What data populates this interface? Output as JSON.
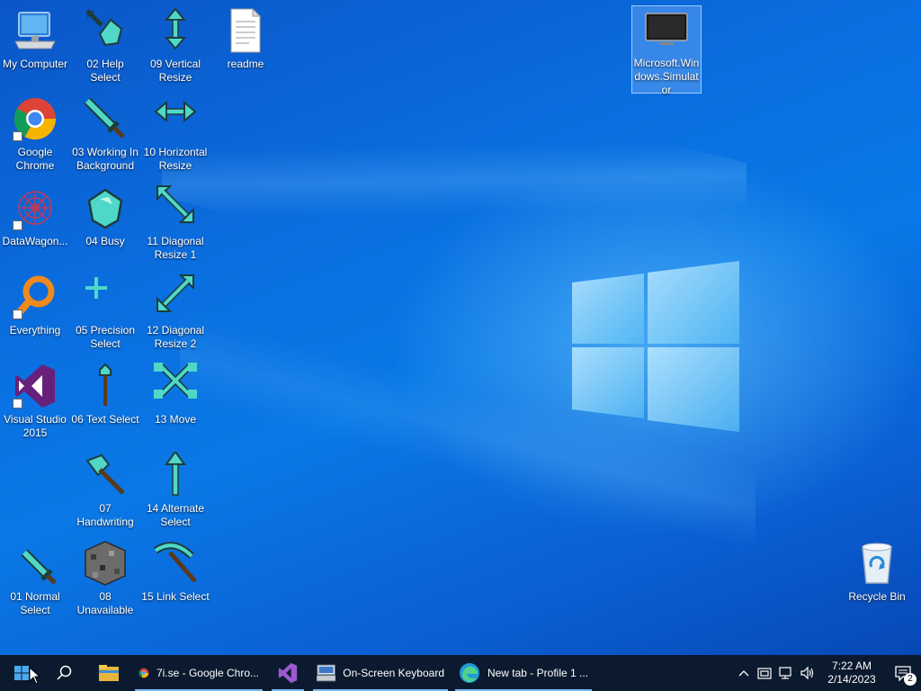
{
  "desktop_icons": {
    "my_computer": "My Computer",
    "help_select": "02 Help Select",
    "vertical_resize": "09 Vertical Resize",
    "readme": "readme",
    "ms_simulator": "Microsoft.Windows.Simulator",
    "chrome": "Google Chrome",
    "working_bg": "03 Working In Background",
    "horizontal_resize": "10 Horizontal Resize",
    "datawagon": "DataWagon...",
    "busy": "04 Busy",
    "diag_resize1": "11 Diagonal Resize 1",
    "everything": "Everything",
    "precision_select": "05 Precision Select",
    "diag_resize2": "12 Diagonal Resize 2",
    "visual_studio": "Visual Studio 2015",
    "text_select": "06 Text Select",
    "move": "13 Move",
    "handwriting": "07 Handwriting",
    "alternate_select": "14 Alternate Select",
    "normal_select": "01 Normal Select",
    "unavailable": "08 Unavailable",
    "link_select": "15 Link Select",
    "recycle_bin": "Recycle Bin"
  },
  "taskbar": {
    "chrome_window": "7i.se - Google Chro...",
    "osk_window": "On-Screen Keyboard",
    "edge_window": "New tab - Profile 1 ...",
    "time": "7:22 AM",
    "date": "2/14/2023",
    "notification_count": "2"
  },
  "colors": {
    "taskbar": "#0b1a2e",
    "accent": "#76b9ed",
    "diamond": "#4fd8c8"
  }
}
